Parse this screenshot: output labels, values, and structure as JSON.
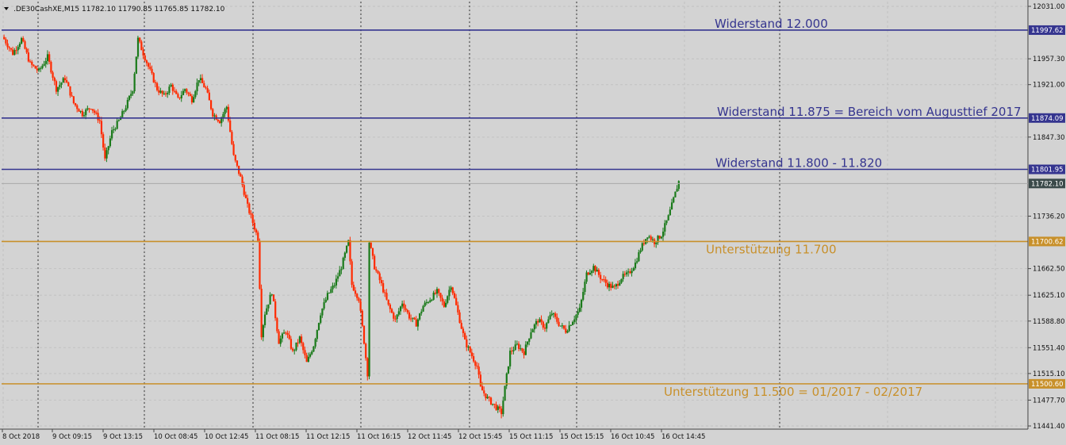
{
  "header": {
    "symbol": ".DE30CashXE,M15",
    "ohlc": "11782.10 11790.85 11765.85 11782.10"
  },
  "colors": {
    "background": "#d3d3d3",
    "grid": "#c2c2c2",
    "bull": "#1a7a1a",
    "bear": "#ff2a00",
    "resistance": "#35358f",
    "support": "#c8902a",
    "price_tag": "#3b4a4a"
  },
  "chart_data": {
    "type": "candlestick",
    "timeframe": "M15",
    "ylim": [
      11441.4,
      12031.0
    ],
    "y_ticks": [
      "12031.00",
      "11957.30",
      "11921.00",
      "11847.30",
      "11736.20",
      "11662.50",
      "11625.10",
      "11588.80",
      "11551.40",
      "11515.10",
      "11477.70",
      "11441.40"
    ],
    "x_ticks": [
      "8 Oct 2018",
      "9 Oct 09:15",
      "9 Oct 13:15",
      "10 Oct 08:45",
      "10 Oct 12:45",
      "11 Oct 08:15",
      "11 Oct 12:15",
      "11 Oct 16:15",
      "12 Oct 11:45",
      "12 Oct 15:45",
      "15 Oct 11:15",
      "15 Oct 15:15",
      "16 Oct 10:45",
      "16 Oct 14:45"
    ],
    "current_price": "11782.10",
    "levels": [
      {
        "value": 11997.62,
        "tag": "11997.62",
        "label": "Widerstand 12.000",
        "kind": "resistance"
      },
      {
        "value": 11874.09,
        "tag": "11874.09",
        "label": "Widerstand 11.875 = Bereich vom Augusttief 2017",
        "kind": "resistance"
      },
      {
        "value": 11801.95,
        "tag": "11801.95",
        "label": "Widerstand 11.800 - 11.820",
        "kind": "resistance"
      },
      {
        "value": 11700.62,
        "tag": "11700.62",
        "label": "Unterstützung 11.700",
        "kind": "support"
      },
      {
        "value": 11500.6,
        "tag": "11500.60",
        "label": "Unterstützung 11.500 = 01/2017 - 02/2017",
        "kind": "support"
      }
    ],
    "close_path": [
      [
        0,
        11985
      ],
      [
        5,
        11965
      ],
      [
        10,
        11985
      ],
      [
        15,
        11950
      ],
      [
        20,
        11940
      ],
      [
        25,
        11960
      ],
      [
        30,
        11915
      ],
      [
        35,
        11930
      ],
      [
        40,
        11895
      ],
      [
        45,
        11880
      ],
      [
        50,
        11890
      ],
      [
        55,
        11870
      ],
      [
        58,
        11815
      ],
      [
        62,
        11855
      ],
      [
        66,
        11870
      ],
      [
        70,
        11890
      ],
      [
        74,
        11915
      ],
      [
        77,
        11985
      ],
      [
        80,
        11965
      ],
      [
        84,
        11940
      ],
      [
        88,
        11915
      ],
      [
        92,
        11905
      ],
      [
        96,
        11920
      ],
      [
        100,
        11900
      ],
      [
        104,
        11915
      ],
      [
        108,
        11900
      ],
      [
        112,
        11930
      ],
      [
        116,
        11915
      ],
      [
        120,
        11880
      ],
      [
        124,
        11870
      ],
      [
        128,
        11890
      ],
      [
        132,
        11820
      ],
      [
        136,
        11790
      ],
      [
        140,
        11750
      ],
      [
        144,
        11720
      ],
      [
        146,
        11705
      ],
      [
        148,
        11570
      ],
      [
        150,
        11600
      ],
      [
        154,
        11630
      ],
      [
        158,
        11560
      ],
      [
        162,
        11575
      ],
      [
        166,
        11545
      ],
      [
        170,
        11565
      ],
      [
        174,
        11530
      ],
      [
        178,
        11555
      ],
      [
        182,
        11600
      ],
      [
        186,
        11625
      ],
      [
        190,
        11640
      ],
      [
        194,
        11665
      ],
      [
        198,
        11700
      ],
      [
        200,
        11640
      ],
      [
        204,
        11620
      ],
      [
        207,
        11560
      ],
      [
        209,
        11515
      ],
      [
        210,
        11700
      ],
      [
        213,
        11665
      ],
      [
        217,
        11640
      ],
      [
        221,
        11610
      ],
      [
        225,
        11590
      ],
      [
        229,
        11615
      ],
      [
        233,
        11595
      ],
      [
        237,
        11585
      ],
      [
        241,
        11610
      ],
      [
        245,
        11620
      ],
      [
        249,
        11630
      ],
      [
        253,
        11610
      ],
      [
        257,
        11640
      ],
      [
        261,
        11600
      ],
      [
        265,
        11560
      ],
      [
        269,
        11540
      ],
      [
        272,
        11525
      ],
      [
        274,
        11495
      ],
      [
        278,
        11480
      ],
      [
        282,
        11470
      ],
      [
        286,
        11460
      ],
      [
        288,
        11495
      ],
      [
        291,
        11545
      ],
      [
        295,
        11555
      ],
      [
        299,
        11545
      ],
      [
        303,
        11575
      ],
      [
        307,
        11590
      ],
      [
        311,
        11580
      ],
      [
        315,
        11600
      ],
      [
        319,
        11585
      ],
      [
        323,
        11575
      ],
      [
        327,
        11590
      ],
      [
        331,
        11605
      ],
      [
        335,
        11655
      ],
      [
        339,
        11665
      ],
      [
        343,
        11650
      ],
      [
        347,
        11640
      ],
      [
        351,
        11635
      ],
      [
        355,
        11650
      ],
      [
        359,
        11655
      ],
      [
        363,
        11670
      ],
      [
        366,
        11690
      ],
      [
        370,
        11710
      ],
      [
        374,
        11700
      ],
      [
        378,
        11710
      ],
      [
        382,
        11735
      ],
      [
        385,
        11760
      ],
      [
        388,
        11785
      ]
    ]
  }
}
